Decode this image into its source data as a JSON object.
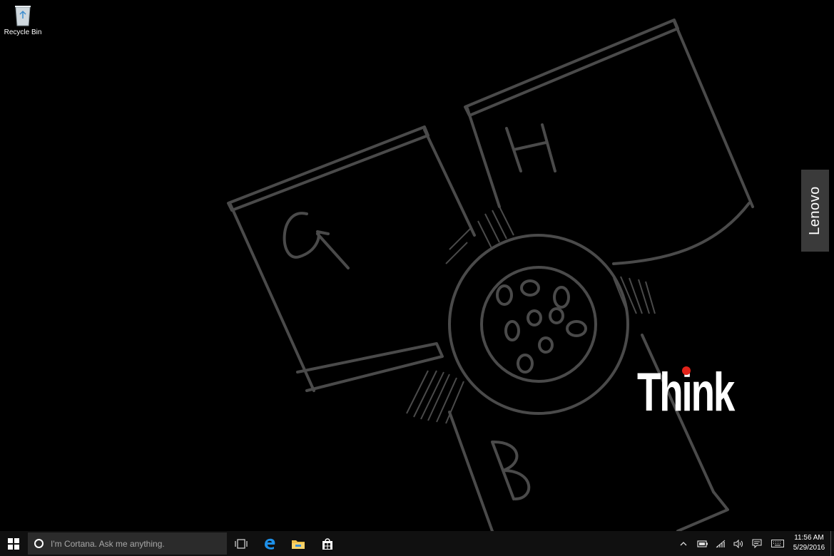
{
  "desktop": {
    "icons": [
      {
        "label": "Recycle Bin",
        "icon": "recycle-bin-icon"
      }
    ]
  },
  "wallpaper": {
    "sketch_letters": [
      "G",
      "H",
      "B"
    ],
    "brand_badge": "Lenovo",
    "brand_logo": "Think",
    "brand_dot_color": "#e2231a"
  },
  "taskbar": {
    "start_icon": "windows-logo-icon",
    "search": {
      "placeholder": "I'm Cortana. Ask me anything."
    },
    "pinned": [
      {
        "name": "task-view",
        "icon": "task-view-icon"
      },
      {
        "name": "edge",
        "icon": "edge-icon"
      },
      {
        "name": "file-explorer",
        "icon": "folder-icon"
      },
      {
        "name": "store",
        "icon": "store-icon"
      }
    ],
    "tray": {
      "icons": [
        "chevron-up-icon",
        "battery-icon",
        "wifi-icon",
        "volume-icon",
        "action-center-icon",
        "keyboard-icon"
      ]
    },
    "clock": {
      "time": "11:56 AM",
      "date": "5/29/2016"
    }
  }
}
